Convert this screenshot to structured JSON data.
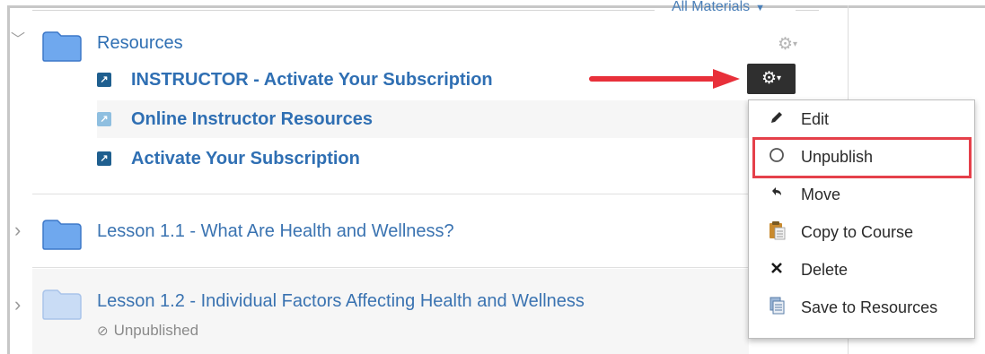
{
  "filter": {
    "label": "All Materials",
    "caret": "▼"
  },
  "module_resources": {
    "title": "Resources",
    "chevron": "﹀",
    "folder_color": "#6fa8ee",
    "items": [
      {
        "label": "INSTRUCTOR - Activate Your Subscription",
        "published": true,
        "icon": "external-link-icon"
      },
      {
        "label": "Online Instructor Resources",
        "published": false,
        "icon": "external-link-icon"
      },
      {
        "label": "Activate Your Subscription",
        "published": true,
        "icon": "external-link-icon"
      }
    ],
    "gear_icon": "⚙",
    "gear_caret": "▾"
  },
  "lesson_1": {
    "title": "Lesson 1.1 - What Are Health and Wellness?",
    "chevron": "›",
    "folder_color": "#6fa8ee"
  },
  "lesson_2": {
    "title": "Lesson 1.2 - Individual Factors Affecting Health and Wellness",
    "chevron": "›",
    "folder_color": "#c9dcf5",
    "status": "Unpublished",
    "status_icon": "⊘"
  },
  "context_menu": {
    "items": [
      {
        "label": "Edit",
        "icon": "pencil-icon",
        "glyph": "✎"
      },
      {
        "label": "Unpublish",
        "icon": "circle-icon",
        "glyph": "○"
      },
      {
        "label": "Move",
        "icon": "move-icon",
        "glyph": "↰"
      },
      {
        "label": "Copy to Course",
        "icon": "clipboard-icon",
        "glyph": "📋"
      },
      {
        "label": "Delete",
        "icon": "x-icon",
        "glyph": "✕"
      },
      {
        "label": "Save to Resources",
        "icon": "save-resources-icon",
        "glyph": "🗐"
      }
    ]
  },
  "colors": {
    "link": "#2f6fb3",
    "highlight": "#e5404a",
    "arrow": "#e8303a",
    "gear_active_bg": "#2f2f2f"
  }
}
